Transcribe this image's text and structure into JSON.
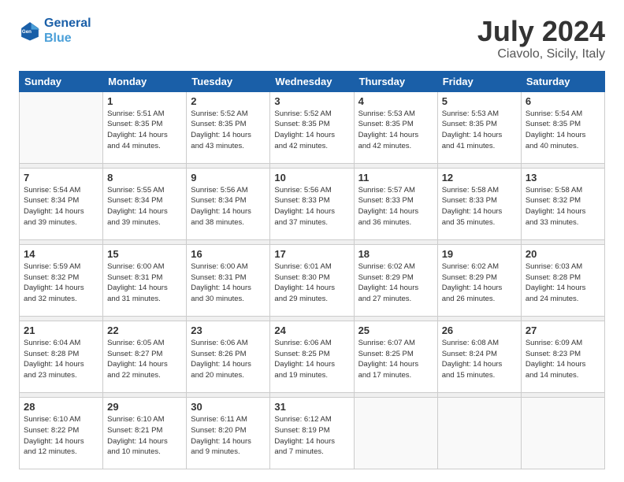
{
  "logo": {
    "line1": "General",
    "line2": "Blue"
  },
  "header": {
    "month": "July 2024",
    "location": "Ciavolo, Sicily, Italy"
  },
  "weekdays": [
    "Sunday",
    "Monday",
    "Tuesday",
    "Wednesday",
    "Thursday",
    "Friday",
    "Saturday"
  ],
  "weeks": [
    [
      {
        "day": "",
        "info": ""
      },
      {
        "day": "1",
        "info": "Sunrise: 5:51 AM\nSunset: 8:35 PM\nDaylight: 14 hours\nand 44 minutes."
      },
      {
        "day": "2",
        "info": "Sunrise: 5:52 AM\nSunset: 8:35 PM\nDaylight: 14 hours\nand 43 minutes."
      },
      {
        "day": "3",
        "info": "Sunrise: 5:52 AM\nSunset: 8:35 PM\nDaylight: 14 hours\nand 42 minutes."
      },
      {
        "day": "4",
        "info": "Sunrise: 5:53 AM\nSunset: 8:35 PM\nDaylight: 14 hours\nand 42 minutes."
      },
      {
        "day": "5",
        "info": "Sunrise: 5:53 AM\nSunset: 8:35 PM\nDaylight: 14 hours\nand 41 minutes."
      },
      {
        "day": "6",
        "info": "Sunrise: 5:54 AM\nSunset: 8:35 PM\nDaylight: 14 hours\nand 40 minutes."
      }
    ],
    [
      {
        "day": "7",
        "info": "Sunrise: 5:54 AM\nSunset: 8:34 PM\nDaylight: 14 hours\nand 39 minutes."
      },
      {
        "day": "8",
        "info": "Sunrise: 5:55 AM\nSunset: 8:34 PM\nDaylight: 14 hours\nand 39 minutes."
      },
      {
        "day": "9",
        "info": "Sunrise: 5:56 AM\nSunset: 8:34 PM\nDaylight: 14 hours\nand 38 minutes."
      },
      {
        "day": "10",
        "info": "Sunrise: 5:56 AM\nSunset: 8:33 PM\nDaylight: 14 hours\nand 37 minutes."
      },
      {
        "day": "11",
        "info": "Sunrise: 5:57 AM\nSunset: 8:33 PM\nDaylight: 14 hours\nand 36 minutes."
      },
      {
        "day": "12",
        "info": "Sunrise: 5:58 AM\nSunset: 8:33 PM\nDaylight: 14 hours\nand 35 minutes."
      },
      {
        "day": "13",
        "info": "Sunrise: 5:58 AM\nSunset: 8:32 PM\nDaylight: 14 hours\nand 33 minutes."
      }
    ],
    [
      {
        "day": "14",
        "info": "Sunrise: 5:59 AM\nSunset: 8:32 PM\nDaylight: 14 hours\nand 32 minutes."
      },
      {
        "day": "15",
        "info": "Sunrise: 6:00 AM\nSunset: 8:31 PM\nDaylight: 14 hours\nand 31 minutes."
      },
      {
        "day": "16",
        "info": "Sunrise: 6:00 AM\nSunset: 8:31 PM\nDaylight: 14 hours\nand 30 minutes."
      },
      {
        "day": "17",
        "info": "Sunrise: 6:01 AM\nSunset: 8:30 PM\nDaylight: 14 hours\nand 29 minutes."
      },
      {
        "day": "18",
        "info": "Sunrise: 6:02 AM\nSunset: 8:29 PM\nDaylight: 14 hours\nand 27 minutes."
      },
      {
        "day": "19",
        "info": "Sunrise: 6:02 AM\nSunset: 8:29 PM\nDaylight: 14 hours\nand 26 minutes."
      },
      {
        "day": "20",
        "info": "Sunrise: 6:03 AM\nSunset: 8:28 PM\nDaylight: 14 hours\nand 24 minutes."
      }
    ],
    [
      {
        "day": "21",
        "info": "Sunrise: 6:04 AM\nSunset: 8:28 PM\nDaylight: 14 hours\nand 23 minutes."
      },
      {
        "day": "22",
        "info": "Sunrise: 6:05 AM\nSunset: 8:27 PM\nDaylight: 14 hours\nand 22 minutes."
      },
      {
        "day": "23",
        "info": "Sunrise: 6:06 AM\nSunset: 8:26 PM\nDaylight: 14 hours\nand 20 minutes."
      },
      {
        "day": "24",
        "info": "Sunrise: 6:06 AM\nSunset: 8:25 PM\nDaylight: 14 hours\nand 19 minutes."
      },
      {
        "day": "25",
        "info": "Sunrise: 6:07 AM\nSunset: 8:25 PM\nDaylight: 14 hours\nand 17 minutes."
      },
      {
        "day": "26",
        "info": "Sunrise: 6:08 AM\nSunset: 8:24 PM\nDaylight: 14 hours\nand 15 minutes."
      },
      {
        "day": "27",
        "info": "Sunrise: 6:09 AM\nSunset: 8:23 PM\nDaylight: 14 hours\nand 14 minutes."
      }
    ],
    [
      {
        "day": "28",
        "info": "Sunrise: 6:10 AM\nSunset: 8:22 PM\nDaylight: 14 hours\nand 12 minutes."
      },
      {
        "day": "29",
        "info": "Sunrise: 6:10 AM\nSunset: 8:21 PM\nDaylight: 14 hours\nand 10 minutes."
      },
      {
        "day": "30",
        "info": "Sunrise: 6:11 AM\nSunset: 8:20 PM\nDaylight: 14 hours\nand 9 minutes."
      },
      {
        "day": "31",
        "info": "Sunrise: 6:12 AM\nSunset: 8:19 PM\nDaylight: 14 hours\nand 7 minutes."
      },
      {
        "day": "",
        "info": ""
      },
      {
        "day": "",
        "info": ""
      },
      {
        "day": "",
        "info": ""
      }
    ]
  ]
}
